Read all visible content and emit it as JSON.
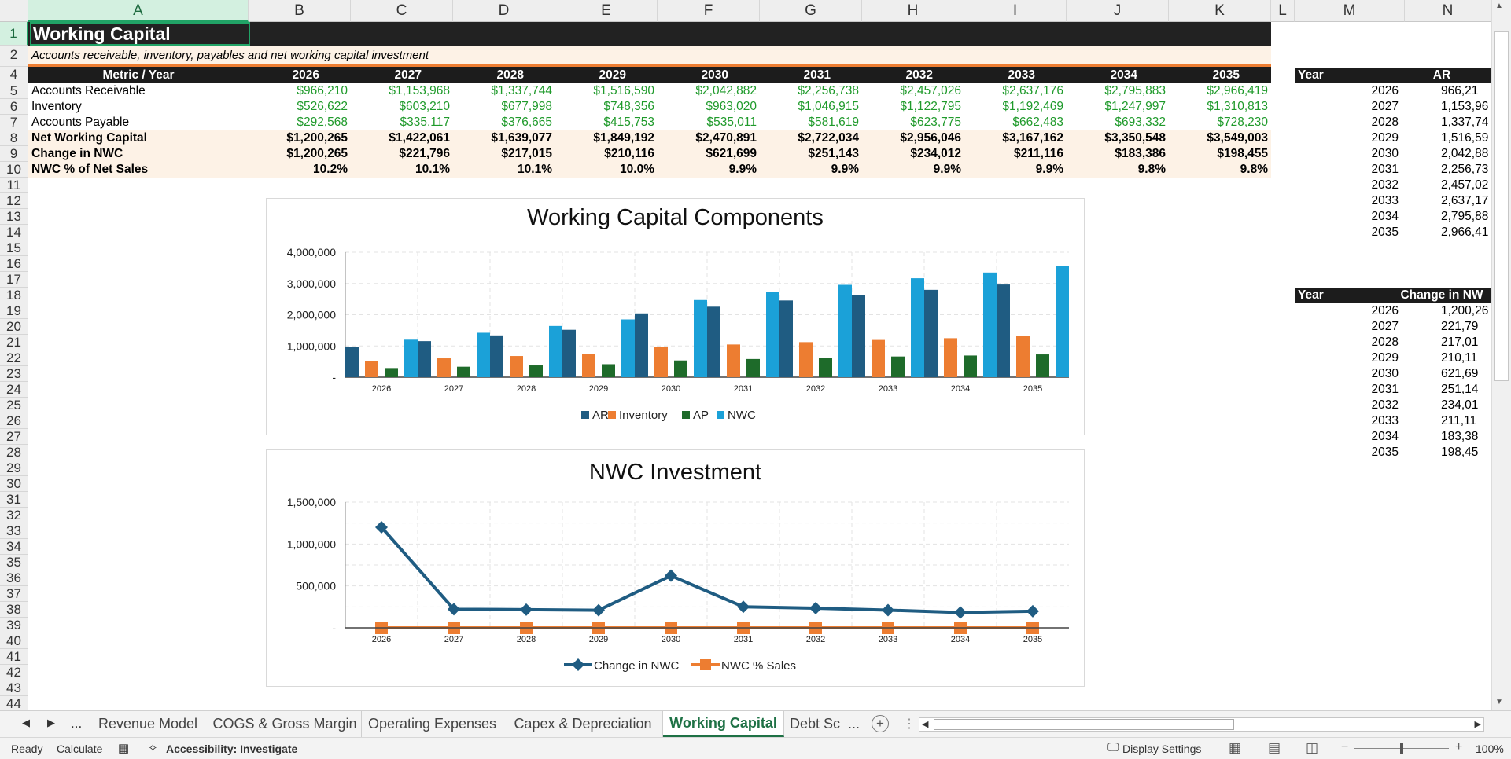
{
  "columns": {
    "A": "A",
    "B": "B",
    "C": "C",
    "D": "D",
    "E": "E",
    "F": "F",
    "G": "G",
    "H": "H",
    "I": "I",
    "J": "J",
    "K": "K",
    "L": "L",
    "M": "M",
    "N": "N"
  },
  "title": "Working Capital",
  "subtitle": "Accounts receivable, inventory, payables and net working capital investment",
  "table": {
    "header_label": "Metric / Year",
    "years": [
      "2026",
      "2027",
      "2028",
      "2029",
      "2030",
      "2031",
      "2032",
      "2033",
      "2034",
      "2035"
    ],
    "rows": [
      {
        "label": "Accounts Receivable",
        "values": [
          "$966,210",
          "$1,153,968",
          "$1,337,744",
          "$1,516,590",
          "$2,042,882",
          "$2,256,738",
          "$2,457,026",
          "$2,637,176",
          "$2,795,883",
          "$2,966,419"
        ]
      },
      {
        "label": "Inventory",
        "values": [
          "$526,622",
          "$603,210",
          "$677,998",
          "$748,356",
          "$963,020",
          "$1,046,915",
          "$1,122,795",
          "$1,192,469",
          "$1,247,997",
          "$1,310,813"
        ]
      },
      {
        "label": "Accounts Payable",
        "values": [
          "$292,568",
          "$335,117",
          "$376,665",
          "$415,753",
          "$535,011",
          "$581,619",
          "$623,775",
          "$662,483",
          "$693,332",
          "$728,230"
        ]
      },
      {
        "label": "Net Working Capital",
        "values": [
          "$1,200,265",
          "$1,422,061",
          "$1,639,077",
          "$1,849,192",
          "$2,470,891",
          "$2,722,034",
          "$2,956,046",
          "$3,167,162",
          "$3,350,548",
          "$3,549,003"
        ]
      },
      {
        "label": "Change in NWC",
        "values": [
          "$1,200,265",
          "$221,796",
          "$217,015",
          "$210,116",
          "$621,699",
          "$251,143",
          "$234,012",
          "$211,116",
          "$183,386",
          "$198,455"
        ]
      },
      {
        "label": "NWC % of Net Sales",
        "values": [
          "10.2%",
          "10.1%",
          "10.1%",
          "10.0%",
          "9.9%",
          "9.9%",
          "9.9%",
          "9.9%",
          "9.8%",
          "9.8%"
        ]
      }
    ]
  },
  "side_table_ar": {
    "h1": "Year",
    "h2": "AR",
    "rows": [
      [
        "2026",
        "966,21"
      ],
      [
        "2027",
        "1,153,96"
      ],
      [
        "2028",
        "1,337,74"
      ],
      [
        "2029",
        "1,516,59"
      ],
      [
        "2030",
        "2,042,88"
      ],
      [
        "2031",
        "2,256,73"
      ],
      [
        "2032",
        "2,457,02"
      ],
      [
        "2033",
        "2,637,17"
      ],
      [
        "2034",
        "2,795,88"
      ],
      [
        "2035",
        "2,966,41"
      ]
    ]
  },
  "side_table_nwc": {
    "h1": "Year",
    "h2": "Change in NW",
    "rows": [
      [
        "2026",
        "1,200,26"
      ],
      [
        "2027",
        "221,79"
      ],
      [
        "2028",
        "217,01"
      ],
      [
        "2029",
        "210,11"
      ],
      [
        "2030",
        "621,69"
      ],
      [
        "2031",
        "251,14"
      ],
      [
        "2032",
        "234,01"
      ],
      [
        "2033",
        "211,11"
      ],
      [
        "2034",
        "183,38"
      ],
      [
        "2035",
        "198,45"
      ]
    ]
  },
  "chart_data": [
    {
      "type": "bar",
      "title": "Working Capital Components",
      "categories": [
        "2026",
        "2027",
        "2028",
        "2029",
        "2030",
        "2031",
        "2032",
        "2033",
        "2034",
        "2035"
      ],
      "ylim": [
        0,
        4000000
      ],
      "yticks": [
        "4,000,000",
        "3,000,000",
        "2,000,000",
        "1,000,000",
        "-"
      ],
      "grid": true,
      "legend": "bottom",
      "series": [
        {
          "name": "AR",
          "color": "#1f5c82",
          "values": [
            966210,
            1153968,
            1337744,
            1516590,
            2042882,
            2256738,
            2457026,
            2637176,
            2795883,
            2966419
          ]
        },
        {
          "name": "Inventory",
          "color": "#ed7d31",
          "values": [
            526622,
            603210,
            677998,
            748356,
            963020,
            1046915,
            1122795,
            1192469,
            1247997,
            1310813
          ]
        },
        {
          "name": "AP",
          "color": "#1e6b2a",
          "values": [
            292568,
            335117,
            376665,
            415753,
            535011,
            581619,
            623775,
            662483,
            693332,
            728230
          ]
        },
        {
          "name": "NWC",
          "color": "#1ba1d8",
          "values": [
            1200265,
            1422061,
            1639077,
            1849192,
            2470891,
            2722034,
            2956046,
            3167162,
            3350548,
            3549003
          ]
        }
      ]
    },
    {
      "type": "line",
      "title": "NWC Investment",
      "categories": [
        "2026",
        "2027",
        "2028",
        "2029",
        "2030",
        "2031",
        "2032",
        "2033",
        "2034",
        "2035"
      ],
      "ylim": [
        0,
        1500000
      ],
      "yticks": [
        "1,500,000",
        "1,000,000",
        "500,000",
        "-"
      ],
      "grid": true,
      "legend": "bottom",
      "series": [
        {
          "name": "Change in NWC",
          "color": "#1f5c82",
          "marker": "diamond",
          "values": [
            1200265,
            221796,
            217015,
            210116,
            621699,
            251143,
            234012,
            211116,
            183386,
            198455
          ]
        },
        {
          "name": "NWC % Sales",
          "color": "#ed7d31",
          "marker": "square",
          "values": [
            0.102,
            0.101,
            0.101,
            0.1,
            0.099,
            0.099,
            0.099,
            0.099,
            0.098,
            0.098
          ]
        }
      ]
    }
  ],
  "tabs": {
    "nav_more": "...",
    "items": [
      "Revenue Model",
      "COGS & Gross Margin",
      "Operating Expenses",
      "Capex & Depreciation",
      "Working Capital",
      "Debt Sc"
    ],
    "more": "..."
  },
  "status": {
    "ready": "Ready",
    "calculate": "Calculate",
    "accessibility": "Accessibility: Investigate",
    "display_settings": "Display Settings",
    "zoom": "100%"
  }
}
